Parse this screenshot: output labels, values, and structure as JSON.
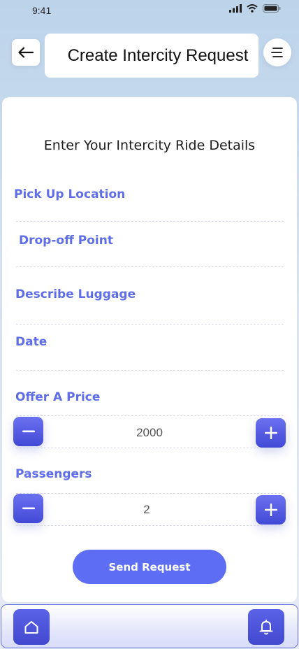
{
  "status_bar": {
    "time": "9:41"
  },
  "header": {
    "back_icon": "arrow-left-icon",
    "title": "Create Intercity Request",
    "menu_icon": "menu-icon"
  },
  "form": {
    "heading": "Enter Your Intercity Ride Details",
    "pickup_label": "Pick Up Location",
    "dropoff_label": "Drop-off Point",
    "luggage_label": "Describe Luggage",
    "date_label": "Date",
    "price": {
      "label": "Offer A Price",
      "value": "2000"
    },
    "passengers": {
      "label": "Passengers",
      "value": "2"
    },
    "send_label": "Send Request"
  },
  "bottom_nav": {
    "home_icon": "home-icon",
    "notifications_icon": "bell-icon"
  },
  "colors": {
    "accent": "#5f6ee8",
    "button": "#5d6ef5",
    "stepper": "#4b52dc"
  }
}
